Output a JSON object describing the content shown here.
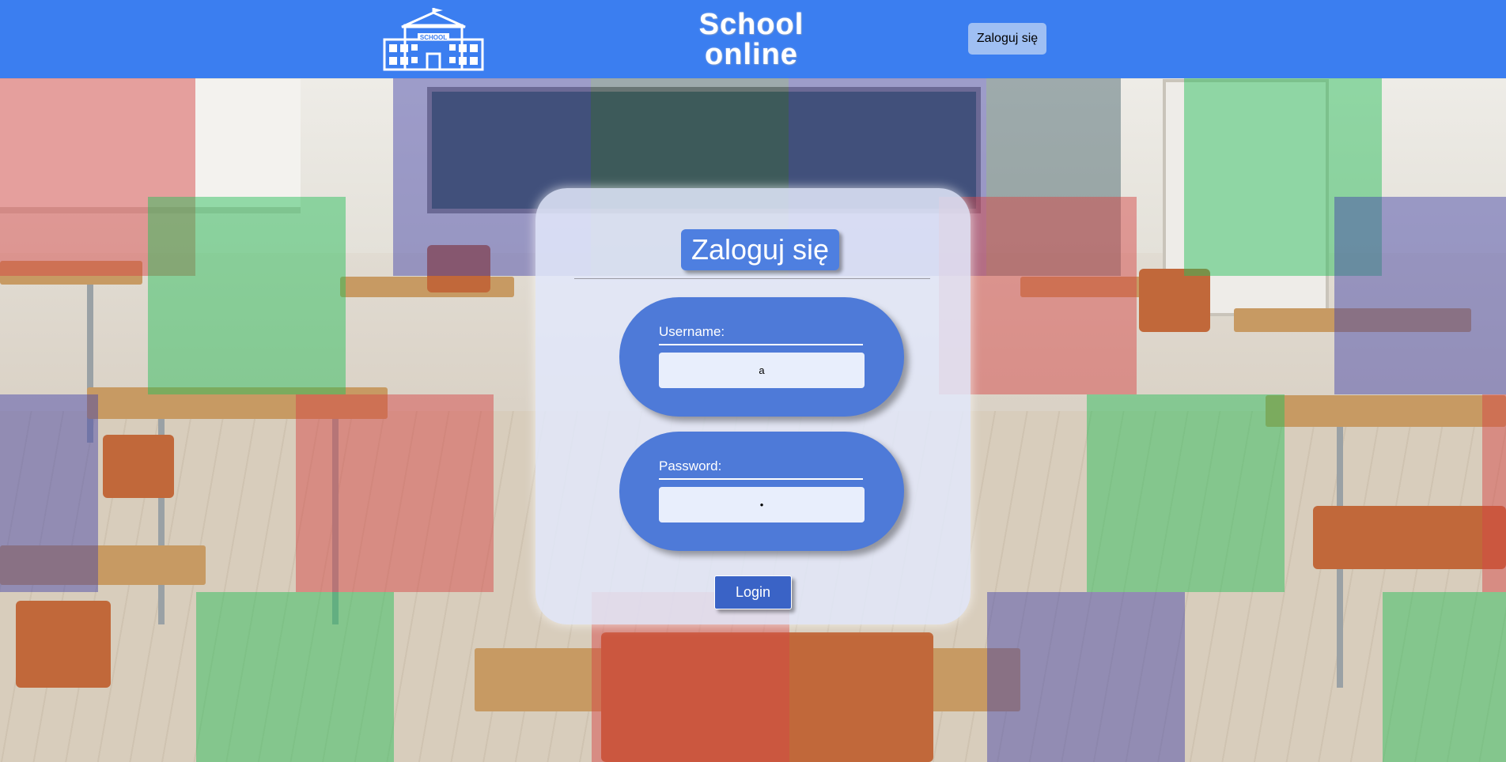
{
  "header": {
    "logo_text": "SCHOOL",
    "brand_line1": "School",
    "brand_line2": "online",
    "login_link_label": "Zaloguj się",
    "bg_color": "#3b7ef0"
  },
  "panel": {
    "title": "Zaloguj się",
    "username": {
      "label": "Username:",
      "value": "a"
    },
    "password": {
      "label": "Password:",
      "value": "•"
    },
    "submit_label": "Login"
  },
  "colors": {
    "accent": "#4e7ad8",
    "button": "#3a63c6",
    "tile_red": "#d64646",
    "tile_green": "#28be5a",
    "tile_blue": "#4646aa"
  }
}
